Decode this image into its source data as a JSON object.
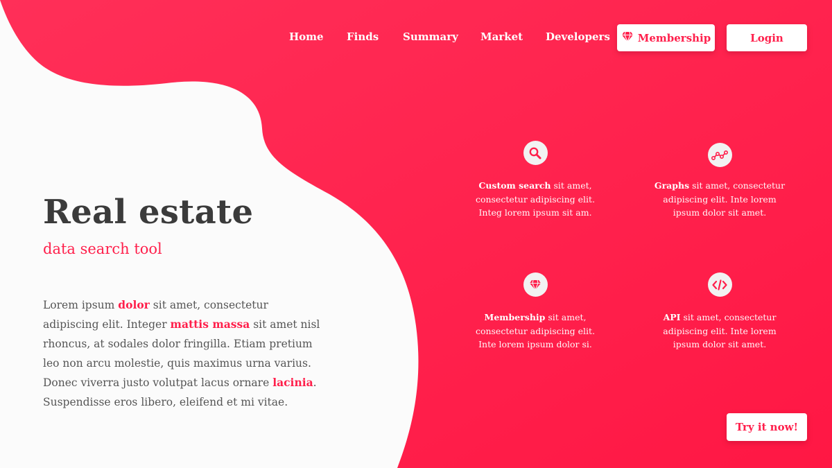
{
  "colors": {
    "accent": "#ff1f4b",
    "accent_light": "#ff2d57",
    "background": "#fbfbfb",
    "heading": "#3b3b3b"
  },
  "nav": {
    "links": [
      {
        "label": "Home"
      },
      {
        "label": "Finds"
      },
      {
        "label": "Summary"
      },
      {
        "label": "Market"
      },
      {
        "label": "Developers"
      }
    ],
    "membership_button": {
      "label": "Membership",
      "icon": "diamond-icon"
    },
    "login_button": {
      "label": "Login"
    }
  },
  "hero": {
    "title": "Real estate",
    "subtitle": "data search tool",
    "body": {
      "t1": "Lorem ipsum ",
      "h1": "dolor",
      "t2": " sit amet, consectetur adipiscing elit. Integer ",
      "h2": "mattis massa",
      "t3": " sit amet nisl rhoncus, at sodales dolor fringilla. Etiam pretium leo non arcu molestie, quis maximus urna varius. Donec viverra justo volutpat lacus ornare ",
      "h3": "lacinia",
      "t4": ". Suspendisse eros libero, eleifend et mi vitae."
    }
  },
  "features": [
    {
      "icon": "search-icon",
      "title": "Custom search",
      "text": " sit amet, consectetur adipiscing elit. Integ lorem ipsum sit am."
    },
    {
      "icon": "graph-icon",
      "title": "Graphs",
      "text": " sit amet, consectetur adipiscing elit. Inte lorem ipsum dolor sit amet."
    },
    {
      "icon": "diamond-icon",
      "title": "Membership",
      "text": " sit amet, consectetur adipiscing elit. Inte lorem ipsum dolor si."
    },
    {
      "icon": "code-icon",
      "title": "API",
      "text": " sit amet, consectetur adipiscing elit. Inte lorem ipsum dolor sit amet."
    }
  ],
  "cta": {
    "label": "Try it now!"
  }
}
